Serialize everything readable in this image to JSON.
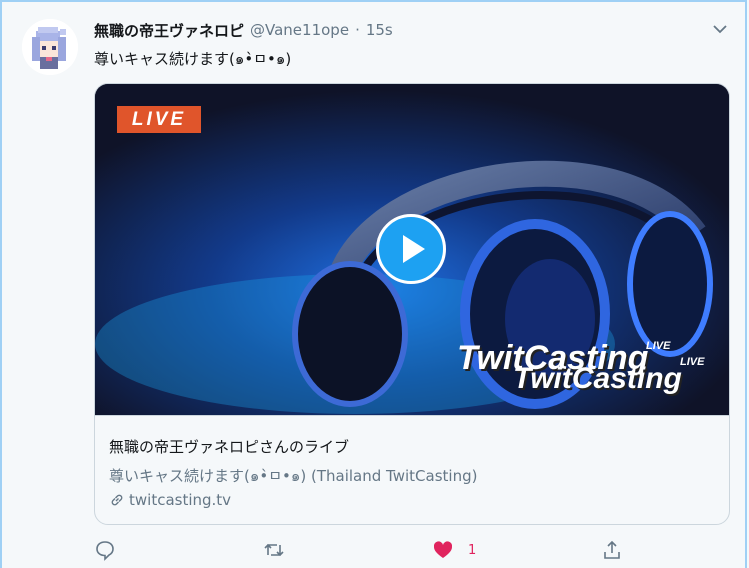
{
  "tweet": {
    "display_name": "無職の帝王ヴァネロピ",
    "handle": "@Vane11ope",
    "separator": "·",
    "time": "15s",
    "text": "尊いキャス続けます(๑•̀ㅁ•๑)"
  },
  "card": {
    "badge": "LIVE",
    "brand_text": "TwitCasting",
    "brand_live": "LIVE",
    "title": "無職の帝王ヴァネロピさんのライブ",
    "description": "尊いキャス続けます(๑•̀ㅁ•๑) (Thailand TwitCasting)",
    "domain": "twitcasting.tv"
  },
  "actions": {
    "like_count": "1"
  },
  "colors": {
    "accent": "#1da1f2",
    "like": "#e0245e",
    "live_badge": "#e0552b",
    "muted": "#657786"
  },
  "icons": [
    "chevron-down-icon",
    "play-icon",
    "link-icon",
    "reply-icon",
    "retweet-icon",
    "heart-icon",
    "share-icon"
  ]
}
